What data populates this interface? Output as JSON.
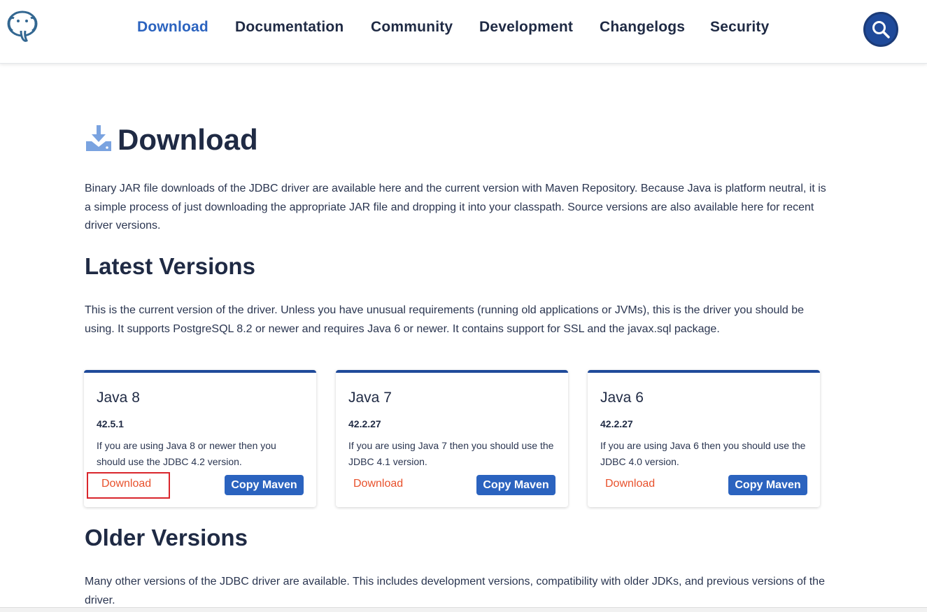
{
  "nav": {
    "items": [
      {
        "label": "Download",
        "active": true
      },
      {
        "label": "Documentation",
        "active": false
      },
      {
        "label": "Community",
        "active": false
      },
      {
        "label": "Development",
        "active": false
      },
      {
        "label": "Changelogs",
        "active": false
      },
      {
        "label": "Security",
        "active": false
      }
    ],
    "search_icon": "search-icon",
    "logo_icon": "elephant-logo-icon"
  },
  "page": {
    "title": "Download",
    "title_icon": "download-icon",
    "intro": "Binary JAR file downloads of the JDBC driver are available here and the current version with Maven Repository. Because Java is platform neutral, it is a simple process of just downloading the appropriate JAR file and dropping it into your classpath. Source versions are also available here for recent driver versions."
  },
  "latest": {
    "heading": "Latest Versions",
    "description": "This is the current version of the driver. Unless you have unusual requirements (running old applications or JVMs), this is the driver you should be using. It supports PostgreSQL 8.2 or newer and requires Java 6 or newer. It contains support for SSL and the javax.sql package.",
    "cards": [
      {
        "title": "Java 8",
        "version": "42.5.1",
        "desc": "If you are using Java 8 or newer then you should use the JDBC 4.2 version.",
        "download_label": "Download",
        "maven_label": "Copy Maven"
      },
      {
        "title": "Java 7",
        "version": "42.2.27",
        "desc": "If you are using Java 7 then you should use the JDBC 4.1 version.",
        "download_label": "Download",
        "maven_label": "Copy Maven"
      },
      {
        "title": "Java 6",
        "version": "42.2.27",
        "desc": "If you are using Java 6 then you should use the JDBC 4.0 version.",
        "download_label": "Download",
        "maven_label": "Copy Maven"
      }
    ]
  },
  "older": {
    "heading": "Older Versions",
    "description": "Many other versions of the JDBC driver are available. This includes development versions, compatibility with older JDKs, and previous versions of the driver."
  },
  "colors": {
    "accent": "#2b63bf",
    "nav_active": "#2b63bf",
    "download_link": "#e8512c",
    "card_top": "#1f4a9a",
    "highlight": "#d9262c"
  }
}
